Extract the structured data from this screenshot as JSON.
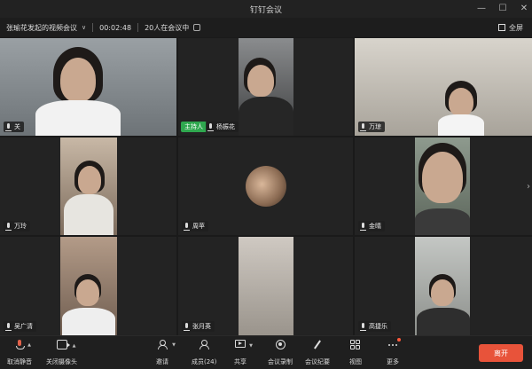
{
  "window": {
    "title": "钉钉会议",
    "controls": {
      "minimize": "—",
      "maximize": "☐",
      "close": "✕"
    }
  },
  "infobar": {
    "meeting_title": "张瑜花发起的视频会议",
    "duration": "00:02:48",
    "participants_label": "20人在会议中",
    "fullscreen_label": "全屏"
  },
  "tiles": [
    {
      "name": "关",
      "mic": "on"
    },
    {
      "name": "杨振花",
      "mic": "on",
      "host_label": "主持人"
    },
    {
      "name": "万琼",
      "mic": "on"
    },
    {
      "name": "万玲",
      "mic": "on"
    },
    {
      "name": "周苹",
      "mic": "on"
    },
    {
      "name": "金晴",
      "mic": "on"
    },
    {
      "name": "吴广清",
      "mic": "on"
    },
    {
      "name": "张月英",
      "mic": "on"
    },
    {
      "name": "高捷乐",
      "mic": "on"
    }
  ],
  "toolbar": {
    "mute_label": "取消静音",
    "camera_label": "关闭摄像头",
    "invite_label": "邀请",
    "members_label": "成员(24)",
    "share_label": "共享",
    "record_label": "会议录制",
    "minutes_label": "会议纪要",
    "view_label": "视图",
    "more_label": "更多",
    "leave_label": "离开"
  },
  "colors": {
    "host_badge": "#2fa84f",
    "leave_button": "#e8533a",
    "muted_mic": "#e2624b"
  }
}
